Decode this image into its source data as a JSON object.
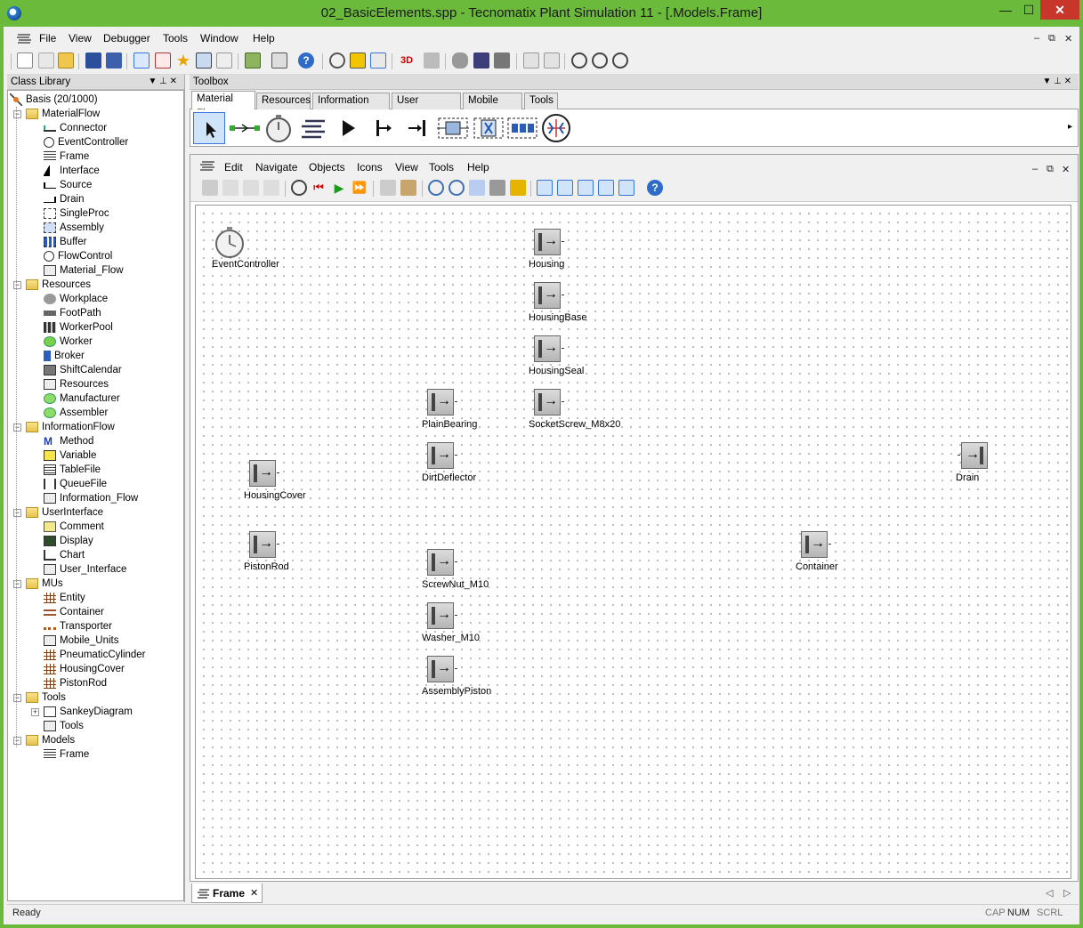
{
  "window": {
    "title": "02_BasicElements.spp - Tecnomatix Plant Simulation 11 - [.Models.Frame]",
    "min": "—",
    "max": "☐",
    "close": "✕"
  },
  "menubar": {
    "items": [
      "File",
      "View",
      "Debugger",
      "Tools",
      "Window",
      "Help"
    ],
    "controls": [
      "–",
      "⧉",
      "✕"
    ]
  },
  "class_library": {
    "title": "Class Library",
    "pin": "▼  ⊥  ✕",
    "root": "Basis (20/1000)",
    "nodes": [
      {
        "label": "MaterialFlow",
        "icon": "folder-icon",
        "level": 1,
        "expander": "−"
      },
      {
        "label": "Connector",
        "icon": "connector-icon",
        "level": 2
      },
      {
        "label": "EventController",
        "icon": "clock-icon",
        "level": 2
      },
      {
        "label": "Frame",
        "icon": "frame-icon",
        "level": 2
      },
      {
        "label": "Interface",
        "icon": "interface-icon",
        "level": 2
      },
      {
        "label": "Source",
        "icon": "source-icon",
        "level": 2
      },
      {
        "label": "Drain",
        "icon": "drain-icon",
        "level": 2
      },
      {
        "label": "SingleProc",
        "icon": "singleproc-icon",
        "level": 2
      },
      {
        "label": "Assembly",
        "icon": "assembly-icon",
        "level": 2
      },
      {
        "label": "Buffer",
        "icon": "buffer-icon",
        "level": 2
      },
      {
        "label": "FlowControl",
        "icon": "flowcontrol-icon",
        "level": 2
      },
      {
        "label": "Material_Flow",
        "icon": "toolbar-icon",
        "level": 2
      },
      {
        "label": "Resources",
        "icon": "folder-icon",
        "level": 1,
        "expander": "−"
      },
      {
        "label": "Workplace",
        "icon": "workplace-icon",
        "level": 2
      },
      {
        "label": "FootPath",
        "icon": "footpath-icon",
        "level": 2
      },
      {
        "label": "WorkerPool",
        "icon": "workerpool-icon",
        "level": 2
      },
      {
        "label": "Worker",
        "icon": "worker-icon",
        "level": 2
      },
      {
        "label": "Broker",
        "icon": "broker-icon",
        "level": 2
      },
      {
        "label": "ShiftCalendar",
        "icon": "calendar-icon",
        "level": 2
      },
      {
        "label": "Resources",
        "icon": "toolbar-icon",
        "level": 2
      },
      {
        "label": "Manufacturer",
        "icon": "manufacturer-icon",
        "level": 2
      },
      {
        "label": "Assembler",
        "icon": "assembler-icon",
        "level": 2
      },
      {
        "label": "InformationFlow",
        "icon": "folder-icon",
        "level": 1,
        "expander": "−"
      },
      {
        "label": "Method",
        "icon": "method-icon",
        "level": 2
      },
      {
        "label": "Variable",
        "icon": "variable-icon",
        "level": 2
      },
      {
        "label": "TableFile",
        "icon": "table-icon",
        "level": 2
      },
      {
        "label": "QueueFile",
        "icon": "queue-icon",
        "level": 2
      },
      {
        "label": "Information_Flow",
        "icon": "toolbar-icon",
        "level": 2
      },
      {
        "label": "UserInterface",
        "icon": "folder-icon",
        "level": 1,
        "expander": "−"
      },
      {
        "label": "Comment",
        "icon": "comment-icon",
        "level": 2
      },
      {
        "label": "Display",
        "icon": "display-icon",
        "level": 2
      },
      {
        "label": "Chart",
        "icon": "chart-icon",
        "level": 2
      },
      {
        "label": "User_Interface",
        "icon": "toolbar-icon",
        "level": 2
      },
      {
        "label": "MUs",
        "icon": "folder-icon",
        "level": 1,
        "expander": "−"
      },
      {
        "label": "Entity",
        "icon": "entity-icon",
        "level": 2
      },
      {
        "label": "Container",
        "icon": "container-icon",
        "level": 2
      },
      {
        "label": "Transporter",
        "icon": "transporter-icon",
        "level": 2
      },
      {
        "label": "Mobile_Units",
        "icon": "toolbar-icon",
        "level": 2
      },
      {
        "label": "PneumaticCylinder",
        "icon": "entity-icon",
        "level": 2
      },
      {
        "label": "HousingCover",
        "icon": "entity-icon",
        "level": 2
      },
      {
        "label": "PistonRod",
        "icon": "entity-icon",
        "level": 2
      },
      {
        "label": "Tools",
        "icon": "folder-icon",
        "level": 1,
        "expander": "−"
      },
      {
        "label": "SankeyDiagram",
        "icon": "sankey-icon",
        "level": 2,
        "expander": "+"
      },
      {
        "label": "Tools",
        "icon": "toolbar-icon",
        "level": 2
      },
      {
        "label": "Models",
        "icon": "folder-icon",
        "level": 1,
        "expander": "−"
      },
      {
        "label": "Frame",
        "icon": "frame-icon",
        "level": 2
      }
    ]
  },
  "toolbox": {
    "title": "Toolbox",
    "controls": "▼  ⊥  ✕",
    "tabs": [
      "Material Flow",
      "Resources",
      "Information Flow",
      "User Interface",
      "Mobile Units",
      "Tools"
    ],
    "selected_tab": "Material Flow",
    "scroll": "▸"
  },
  "frame_window": {
    "menu": [
      "Edit",
      "Navigate",
      "Objects",
      "Icons",
      "View",
      "Tools",
      "Help"
    ],
    "controls": [
      "–",
      "⧉",
      "✕"
    ],
    "tab_label": "Frame",
    "tab_close": "✕",
    "nav": [
      "◁",
      "▷"
    ]
  },
  "canvas_objects": [
    {
      "label": "EventController",
      "kind": "eventcontroller"
    },
    {
      "label": "Housing",
      "kind": "source"
    },
    {
      "label": "HousingBase",
      "kind": "source"
    },
    {
      "label": "HousingSeal",
      "kind": "source"
    },
    {
      "label": "PlainBearing",
      "kind": "source"
    },
    {
      "label": "SocketScrew_M8x20",
      "kind": "source"
    },
    {
      "label": "DirtDeflector",
      "kind": "source"
    },
    {
      "label": "Drain",
      "kind": "drain"
    },
    {
      "label": "HousingCover",
      "kind": "source"
    },
    {
      "label": "PistonRod",
      "kind": "source"
    },
    {
      "label": "ScrewNut_M10",
      "kind": "source"
    },
    {
      "label": "Container",
      "kind": "source"
    },
    {
      "label": "Washer_M10",
      "kind": "source"
    },
    {
      "label": "AssemblyPiston",
      "kind": "source"
    }
  ],
  "statusbar": {
    "left": "Ready",
    "cap": "CAP",
    "num": "NUM",
    "scrl": "SCRL"
  }
}
